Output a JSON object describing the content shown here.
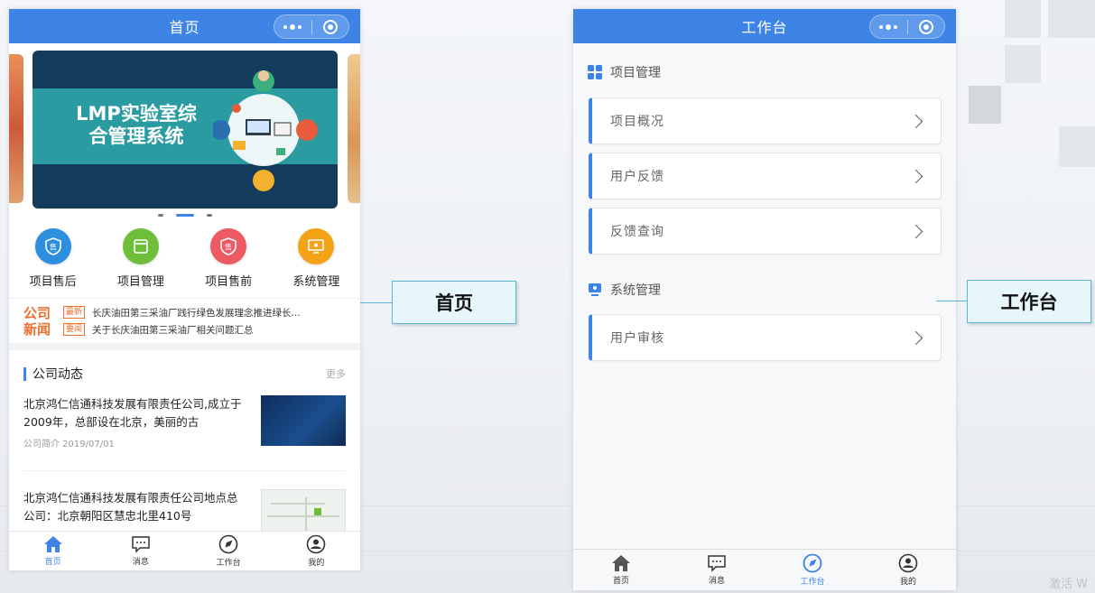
{
  "home": {
    "nav_title": "首页",
    "banner_title_line1": "LMP实验室综",
    "banner_title_line2": "合管理系统",
    "entries": [
      {
        "label": "项目售后",
        "icon": "shield-icon",
        "color": "#2e8fe0"
      },
      {
        "label": "项目管理",
        "icon": "window-icon",
        "color": "#6fbe3a"
      },
      {
        "label": "项目售前",
        "icon": "shield-icon",
        "color": "#ee5a62"
      },
      {
        "label": "系统管理",
        "icon": "monitor-icon",
        "color": "#f4a317"
      }
    ],
    "ticker": {
      "brand_line1": "公司",
      "brand_line2": "新闻",
      "items": [
        {
          "tag": "最新",
          "text": "长庆油田第三采油厂践行绿色发展理念推进绿长..."
        },
        {
          "tag": "要闻",
          "text": "关于长庆油田第三采油厂相关问题汇总"
        }
      ]
    },
    "section_title": "公司动态",
    "section_more": "更多",
    "news": [
      {
        "title": "北京鸿仁信通科技发展有限责任公司,成立于2009年，总部设在北京，美丽的古",
        "meta": "公司简介 2019/07/01"
      },
      {
        "title": "北京鸿仁信通科技发展有限责任公司地点总公司：北京朝阳区慧忠北里410号",
        "meta": ""
      }
    ]
  },
  "workbench": {
    "nav_title": "工作台",
    "sections": [
      {
        "title": "项目管理",
        "icon": "grid-icon",
        "items": [
          "项目概况",
          "用户反馈",
          "反馈查询"
        ]
      },
      {
        "title": "系统管理",
        "icon": "monitor-icon",
        "items": [
          "用户审核"
        ]
      }
    ]
  },
  "tabbar": [
    "首页",
    "消息",
    "工作台",
    "我的"
  ],
  "callouts": {
    "home": "首页",
    "workbench": "工作台"
  },
  "watermark": "激活 W",
  "colors": {
    "primary": "#3d84e6",
    "accent": "#ee6f2d",
    "callout_border": "#56b7d9"
  }
}
